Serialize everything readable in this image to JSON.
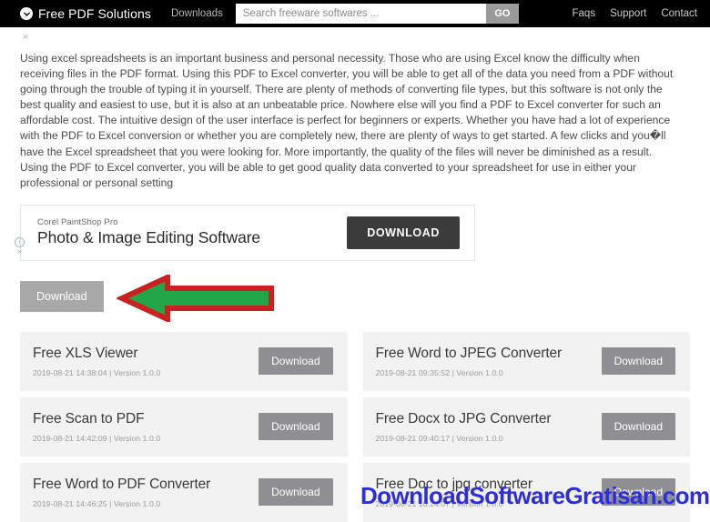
{
  "header": {
    "brand": "Free PDF Solutions",
    "brand_logo_icon": "circle-chevron-down-icon",
    "downloads_label": "Downloads",
    "search_placeholder": "Search freeware softwares ...",
    "search_value": "",
    "go_label": "GO",
    "links": [
      "Faqs",
      "Support",
      "Contact"
    ],
    "background_color": "#000000"
  },
  "page": {
    "top_close_label": "×",
    "article": "Using excel spreadsheets is an important business and personal necessity. Those who are using Excel know the difficulty when receiving files in the PDF format. Using this PDF to Excel converter, you will be able to get all of the data you need from a PDF without going through the trouble of typing it in yourself. There are plenty of methods of converting file types, but this software is not only the best quality and easiest to use, but it is also at an unbeatable price. Nowhere else will you find a PDF to Excel converter for such an affordable cost. The intuitive design of the user interface is perfect for beginners or experts. Whether you have had a lot of experience with the PDF to Excel conversion or whether you are completely new, there are plenty of ways to get started. A few clicks and you�ll have the Excel spreadsheet that you were looking for. More importantly, the quality of the files will never be diminished as a result. Using the PDF to Excel converter, you will be able to get good quality data converted to your spreadsheet for use in either your professional or personal setting"
  },
  "ad": {
    "kicker": "Corel PaintShop Pro",
    "headline": "Photo & Image Editing Software",
    "cta_label": "DOWNLOAD",
    "cta_color": "#3b3b3b",
    "info_icon": "info-circle-icon",
    "close_icon": "×"
  },
  "main_download": {
    "label": "Download",
    "color": "#a8a8a8",
    "annotation": {
      "shape": "left-pointing-arrow",
      "fill_color": "#22a64a",
      "stroke_color": "#cc1f1f"
    }
  },
  "software_list": {
    "download_label": "Download",
    "button_color": "#8f8f93",
    "card_color": "#f2f2f2",
    "items": [
      {
        "title": "Free XLS Viewer",
        "meta": "2019-08-21 14:38:04 | Version 1.0.0"
      },
      {
        "title": "Free Word to JPEG Converter",
        "meta": "2019-08-21 09:35:52 | Version 1.0.0"
      },
      {
        "title": "Free Scan to PDF",
        "meta": "2019-08-21 14:42:09 | Version 1.0.0"
      },
      {
        "title": "Free Docx to JPG Converter",
        "meta": "2019-08-21 09:40:17 | Version 1.0.0"
      },
      {
        "title": "Free Word to PDF Converter",
        "meta": "2019-08-21 14:46:25 | Version 1.0.0"
      },
      {
        "title": "Free Doc to jpg converter",
        "meta": "2019-08-21 10:24:07 | Version 1.0.0"
      }
    ]
  },
  "watermark": {
    "text": "DownloadSoftwareGratisan.com",
    "color": "#2d2de0"
  }
}
